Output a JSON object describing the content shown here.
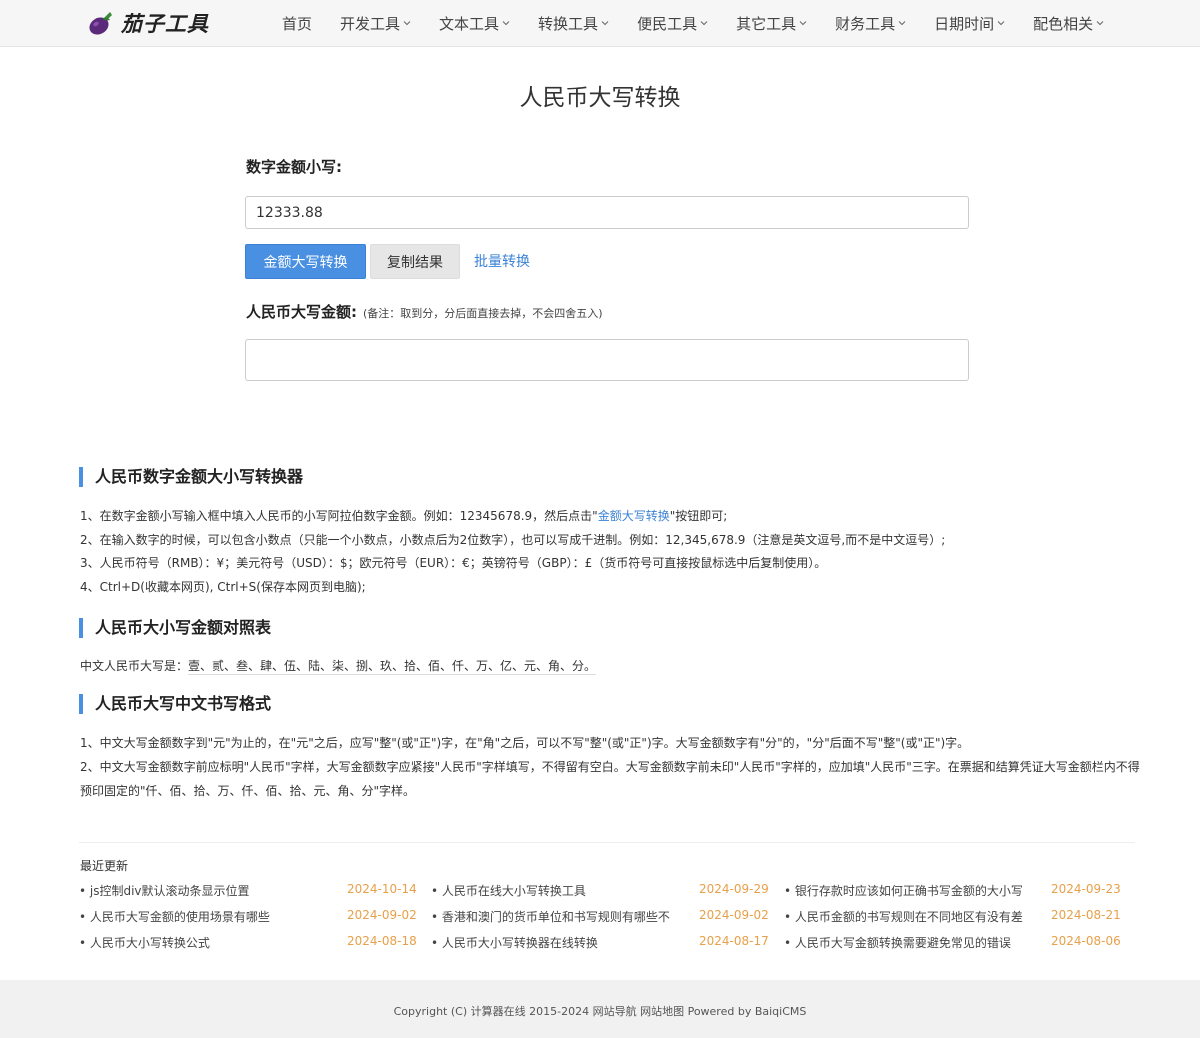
{
  "header": {
    "logo_text": "茄子工具",
    "nav": [
      {
        "label": "首页",
        "dropdown": false
      },
      {
        "label": "开发工具",
        "dropdown": true
      },
      {
        "label": "文本工具",
        "dropdown": true
      },
      {
        "label": "转换工具",
        "dropdown": true
      },
      {
        "label": "便民工具",
        "dropdown": true
      },
      {
        "label": "其它工具",
        "dropdown": true
      },
      {
        "label": "财务工具",
        "dropdown": true
      },
      {
        "label": "日期时间",
        "dropdown": true
      },
      {
        "label": "配色相关",
        "dropdown": true
      }
    ]
  },
  "tool": {
    "title": "人民币大写转换",
    "input_label": "数字金额小写:",
    "input_value": "12333.88",
    "convert_button": "金额大写转换",
    "copy_button": "复制结果",
    "batch_link": "批量转换",
    "result_label": "人民币大写金额:",
    "result_note": "(备注：取到分，分后面直接去掉，不会四舍五入)",
    "result_value": ""
  },
  "article": {
    "section1_title": "人民币数字金额大小写转换器",
    "s1_p1_pre": "1、在数字金额小写输入框中填入人民币的小写阿拉伯数字金额。例如：12345678.9，然后点击\"",
    "s1_p1_link": "金额大写转换",
    "s1_p1_post": "\"按钮即可;",
    "s1_p2": "2、在输入数字的时候，可以包含小数点（只能一个小数点，小数点后为2位数字），也可以写成千进制。例如：12,345,678.9（注意是英文逗号,而不是中文逗号）;",
    "s1_p3": "3、人民币符号（RMB）：¥；美元符号（USD）：$；欧元符号（EUR）：€；英镑符号（GBP）：£（货币符号可直接按鼠标选中后复制使用）。",
    "s1_p4": "4、Ctrl+D(收藏本网页), Ctrl+S(保存本网页到电脑);",
    "section2_title": "人民币大小写金额对照表",
    "s2_prefix": "中文人民币大写是：",
    "s2_chars": "壹、贰、叁、肆、伍、陆、柒、捌、玖、拾、佰、仟、万、亿、元、角、分。",
    "section3_title": "人民币大写中文书写格式",
    "s3_p1": "1、中文大写金额数字到\"元\"为止的，在\"元\"之后，应写\"整\"(或\"正\")字，在\"角\"之后，可以不写\"整\"(或\"正\")字。大写金额数字有\"分\"的，\"分\"后面不写\"整\"(或\"正\")字。",
    "s3_p2": "2、中文大写金额数字前应标明\"人民币\"字样，大写金额数字应紧接\"人民币\"字样填写，不得留有空白。大写金额数字前未印\"人民币\"字样的，应加填\"人民币\"三字。在票据和结算凭证大写金额栏内不得预印固定的\"仟、佰、拾、万、仟、佰、拾、元、角、分\"字样。"
  },
  "recent": {
    "title": "最近更新",
    "items": [
      {
        "title": "• js控制div默认滚动条显示位置",
        "date": "2024-10-14"
      },
      {
        "title": "• 人民币在线大小写转换工具",
        "date": "2024-09-29"
      },
      {
        "title": "• 银行存款时应该如何正确书写金额的大小写",
        "date": "2024-09-23"
      },
      {
        "title": "• 人民币大写金额的使用场景有哪些",
        "date": "2024-09-02"
      },
      {
        "title": "• 香港和澳门的货币单位和书写规则有哪些不",
        "date": "2024-09-02"
      },
      {
        "title": "• 人民币金额的书写规则在不同地区有没有差",
        "date": "2024-08-21"
      },
      {
        "title": "• 人民币大小写转换公式",
        "date": "2024-08-18"
      },
      {
        "title": "• 人民币大小写转换器在线转换",
        "date": "2024-08-17"
      },
      {
        "title": "• 人民币大写金额转换需要避免常见的错误",
        "date": "2024-08-06"
      }
    ]
  },
  "footer": {
    "text": "Copyright (C) 计算器在线 2015-2024 网站导航 网站地图 Powered by BaiqiCMS"
  },
  "colors": {
    "accent": "#4a90e2",
    "link": "#3b82d6",
    "date": "#e8a04a"
  }
}
